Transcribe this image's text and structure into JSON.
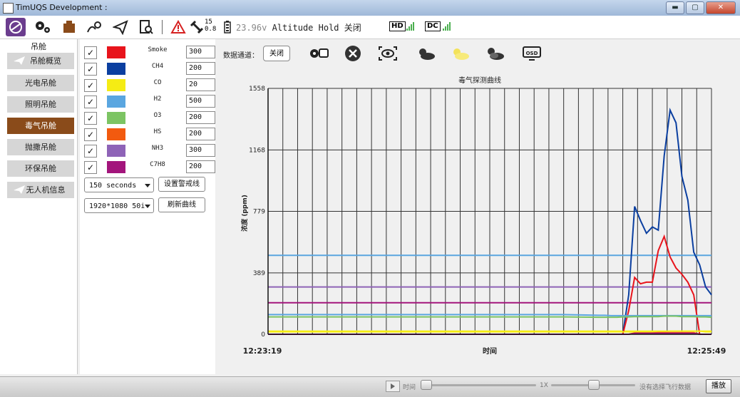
{
  "window": {
    "title": "TimUQS Development :"
  },
  "window_buttons": {
    "minimize": "▬",
    "maximize": "▢",
    "close": "✕"
  },
  "toolbar": {
    "satellites": "15",
    "hdop": "0.8",
    "voltage": "23.96v",
    "altitude_hold": "Altitude Hold",
    "altitude_hold_state": "关闭",
    "hd_label": "HD",
    "dc_label": "DC"
  },
  "sidebar": {
    "header": "吊舱",
    "items": [
      {
        "label": "吊舱概览",
        "icon": "plane-icon"
      },
      {
        "label": "光电吊舱"
      },
      {
        "label": "照明吊舱"
      },
      {
        "label": "毒气吊舱",
        "selected": true
      },
      {
        "label": "抛撒吊舱"
      },
      {
        "label": "环保吊舱"
      },
      {
        "label": "无人机信息",
        "icon": "plane-icon"
      }
    ]
  },
  "gases": [
    {
      "name": "Smoke",
      "color": "#e8141c",
      "threshold": "300",
      "checked": "✓"
    },
    {
      "name": "CH4",
      "color": "#0b3fa0",
      "threshold": "200",
      "checked": "✓"
    },
    {
      "name": "CO",
      "color": "#f5ec14",
      "threshold": "20",
      "checked": "✓"
    },
    {
      "name": "H2",
      "color": "#5aa6e0",
      "threshold": "500",
      "checked": "✓"
    },
    {
      "name": "O3",
      "color": "#7cc463",
      "threshold": "200",
      "checked": "✓"
    },
    {
      "name": "HS",
      "color": "#f25a0f",
      "threshold": "200",
      "checked": "✓"
    },
    {
      "name": "NH3",
      "color": "#8e63b7",
      "threshold": "300",
      "checked": "✓"
    },
    {
      "name": "C7H8",
      "color": "#a3157c",
      "threshold": "200",
      "checked": "✓"
    }
  ],
  "controls": {
    "duration": "150 seconds",
    "set_alarm_button": "设置警戒线",
    "resolution": "1920*1080 50i",
    "refresh_button": "刷新曲线"
  },
  "data_channel": {
    "label": "数据通道：",
    "button": "关闭"
  },
  "chart_data": {
    "type": "line",
    "title": "毒气探测曲线",
    "xlabel": "时间",
    "ylabel": "浓度 (ppm)",
    "x_start_label": "12:23:19",
    "x_end_label": "12:25:49",
    "ylim": [
      0,
      1558
    ],
    "yticks": [
      0,
      389,
      779,
      1168,
      1558
    ],
    "grid": true,
    "x": [
      0,
      100,
      112,
      114,
      116,
      118,
      120,
      122,
      124,
      126,
      128,
      130,
      132,
      134,
      136,
      138,
      140,
      142,
      144,
      146,
      148,
      150
    ],
    "series": [
      {
        "color": "#0b3fa0",
        "values": [
          0,
          0,
          0,
          0,
          0,
          0,
          0,
          250,
          810,
          720,
          640,
          680,
          660,
          1130,
          1420,
          1340,
          1000,
          850,
          520,
          440,
          300,
          250
        ]
      },
      {
        "color": "#e8141c",
        "values": [
          0,
          0,
          0,
          0,
          0,
          0,
          0,
          150,
          360,
          320,
          330,
          330,
          530,
          620,
          490,
          420,
          380,
          330,
          250,
          0,
          0,
          0
        ]
      },
      {
        "color": "#5aa6e0",
        "values": [
          125,
          125,
          120,
          120,
          118,
          118,
          118,
          118,
          118,
          118,
          118,
          118,
          118,
          118,
          118,
          118,
          118,
          118,
          118,
          118,
          118,
          118
        ]
      },
      {
        "color": "#7cc463",
        "values": [
          110,
          110,
          108,
          108,
          108,
          108,
          110,
          110,
          112,
          112,
          112,
          112,
          112,
          115,
          115,
          115,
          112,
          112,
          112,
          110,
          110,
          108
        ]
      },
      {
        "color": "#f5ec14",
        "values": [
          15,
          15,
          15,
          15,
          15,
          15,
          15,
          15,
          15,
          15,
          15,
          15,
          15,
          15,
          20,
          20,
          20,
          20,
          20,
          20,
          15,
          15
        ]
      },
      {
        "color": "#f25a0f",
        "values": [
          0,
          0,
          0,
          0,
          0,
          0,
          0,
          0,
          8,
          8,
          8,
          8,
          10,
          10,
          10,
          10,
          10,
          10,
          10,
          0,
          0,
          0
        ]
      },
      {
        "color": "#a3157c",
        "values": [
          0,
          0,
          0,
          0,
          0,
          0,
          0,
          0,
          6,
          6,
          6,
          6,
          6,
          6,
          6,
          6,
          6,
          6,
          6,
          0,
          0,
          0
        ]
      }
    ],
    "alarm_lines": [
      {
        "color": "#5aa6e0",
        "value": 500
      },
      {
        "color": "#8e63b7",
        "value": 300
      },
      {
        "color": "#a3157c",
        "value": 200
      },
      {
        "color": "#f5ec14",
        "value": 20
      }
    ]
  },
  "bottom": {
    "time_label": "时间",
    "speed_label": "1X",
    "status": "没有选择飞行数据",
    "play_button": "播放",
    "time_progress": 0.0,
    "speed_level": 0.5
  }
}
